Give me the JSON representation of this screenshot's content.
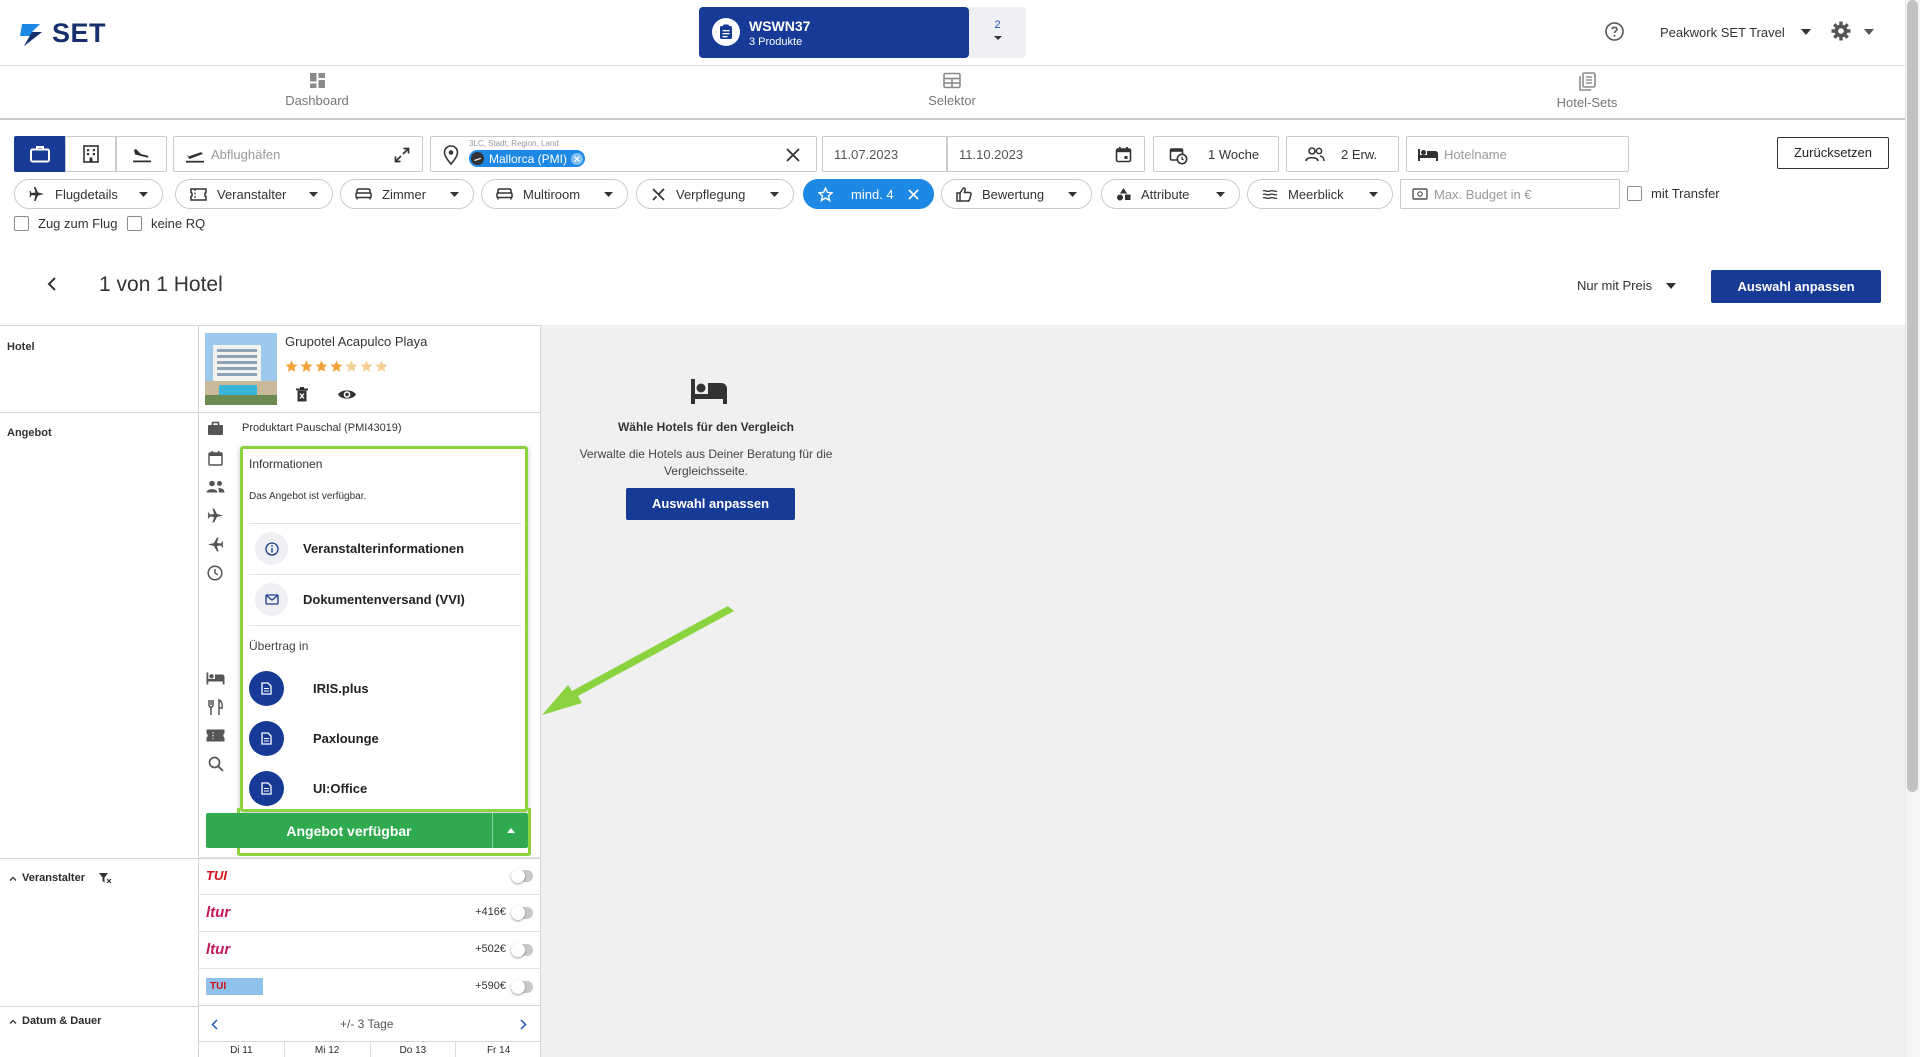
{
  "header": {
    "logo_text": "SET",
    "offer_code": "WSWN37",
    "offer_products": "3 Produkte",
    "offer_count": "2",
    "agency": "Peakwork SET Travel"
  },
  "nav": {
    "items": [
      {
        "label": "Dashboard",
        "icon": "dashboard-icon"
      },
      {
        "label": "Selektor",
        "icon": "grid-icon"
      },
      {
        "label": "Hotel-Sets",
        "icon": "copy-icon"
      }
    ]
  },
  "search": {
    "departure_placeholder": "Abflughäfen",
    "destination_hint": "3LC, Stadt, Region, Land",
    "destination_chip": "Mallorca (PMI)",
    "date_from": "11.07.2023",
    "date_to": "11.10.2023",
    "duration": "1 Woche",
    "travellers": "2 Erw.",
    "hotel_placeholder": "Hotelname",
    "reset_label": "Zurücksetzen"
  },
  "filters": {
    "flugdetails": "Flugdetails",
    "veranstalter": "Veranstalter",
    "zimmer": "Zimmer",
    "multiroom": "Multiroom",
    "verpflegung": "Verpflegung",
    "stars": "mind. 4",
    "bewertung": "Bewertung",
    "attribute": "Attribute",
    "meerblick": "Meerblick",
    "budget_placeholder": "Max. Budget in €",
    "transfer": "mit Transfer",
    "zug": "Zug zum Flug",
    "keine_rq": "keine RQ"
  },
  "results": {
    "title": "1 von 1 Hotel",
    "price_filter": "Nur mit Preis",
    "adjust_label": "Auswahl anpassen"
  },
  "rows": {
    "hotel": "Hotel",
    "angebot": "Angebot",
    "veranstalter": "Veranstalter",
    "datum": "Datum & Dauer"
  },
  "hotel": {
    "name": "Grupotel Acapulco Playa",
    "stars_filled": 4,
    "stars_total": 7,
    "product_type": "Produktart Pauschal (PMI43019)"
  },
  "dropdown": {
    "info_heading": "Informationen",
    "info_text": "Das Angebot ist verfügbar.",
    "items": [
      {
        "label": "Veranstalterinformationen",
        "icon": "info-icon"
      },
      {
        "label": "Dokumentenversand (VVI)",
        "icon": "mail-icon"
      }
    ],
    "transfer_heading": "Übertrag in",
    "transfers": [
      {
        "label": "IRIS.plus"
      },
      {
        "label": "Paxlounge"
      },
      {
        "label": "UI:Office"
      }
    ]
  },
  "cta_label": "Angebot verfügbar",
  "operators": [
    {
      "name": "TUI",
      "price": ""
    },
    {
      "name": "ltur",
      "price": "+416€"
    },
    {
      "name": "ltur",
      "price": "+502€"
    },
    {
      "name": "TUI",
      "price": "+590€"
    }
  ],
  "date_nav": {
    "range": "+/- 3 Tage",
    "days": [
      "Di 11",
      "Mi 12",
      "Do 13",
      "Fr 14"
    ]
  },
  "compare": {
    "heading": "Wähle Hotels für den Vergleich",
    "text": "Verwalte die Hotels aus Deiner Beratung für die Vergleichsseite.",
    "button": "Auswahl anpassen"
  },
  "colors": {
    "brand": "#173a96",
    "active_pill": "#1e88e5",
    "cta_green": "#2faa4e",
    "highlight": "#8bd33f",
    "star": "#f3a23a"
  }
}
